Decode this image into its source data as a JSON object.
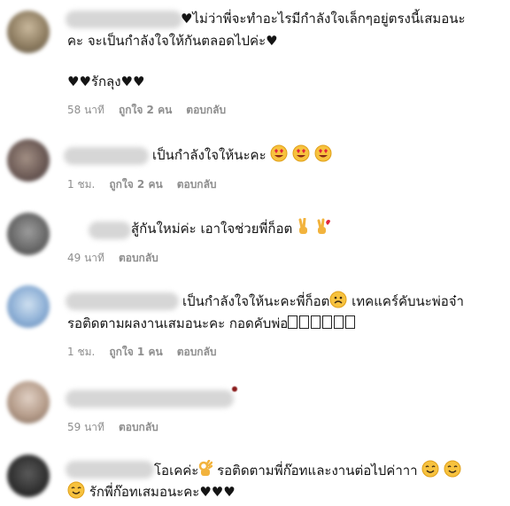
{
  "comments": [
    {
      "lines": [
        "♥ไม่ว่าพี่จะทำอะไรมีกำลังใจเล็กๆอยู่ตรงนี้เสมอนะ",
        "คะ จะเป็นกำลังใจให้กันตลอดไปค่ะ♥",
        "",
        "♥♥รักลุง♥♥"
      ],
      "time": "58 นาที",
      "likes": "ถูกใจ 2 คน",
      "reply": "ตอบกลับ"
    },
    {
      "text": "เป็นกำลังใจให้นะคะ",
      "emoji": [
        "heart-eyes-icon",
        "heart-eyes-icon",
        "heart-eyes-icon"
      ],
      "time": "1 ชม.",
      "likes": "ถูกใจ 2 คน",
      "reply": "ตอบกลับ"
    },
    {
      "text": "สู้กันใหม่ค่ะ เอาใจช่วยพี่ก็อต",
      "emoji": [
        "victory-hand-icon",
        "victory-hand-heart-icon"
      ],
      "time": "49 นาที",
      "reply": "ตอบกลับ"
    },
    {
      "line1": "เป็นกำลังใจให้นะคะพี่ก็อต",
      "line1b": " เทคแคร์คับนะพ่อจ๋า",
      "line2": "รอติดตามผลงานเสมอนะคะ กอดคับพ่อ",
      "time": "1 ชม.",
      "likes": "ถูกใจ 1 คน",
      "reply": "ตอบกลับ"
    },
    {
      "time": "59 นาที",
      "reply": "ตอบกลับ"
    },
    {
      "line1a": "โอเคค่ะ",
      "line1b": " รอติดตามพี่ก๊อทและงานต่อไปค่าาา",
      "line2": " รักพี่ก๊อทเสมอนะคะ♥♥♥"
    }
  ]
}
